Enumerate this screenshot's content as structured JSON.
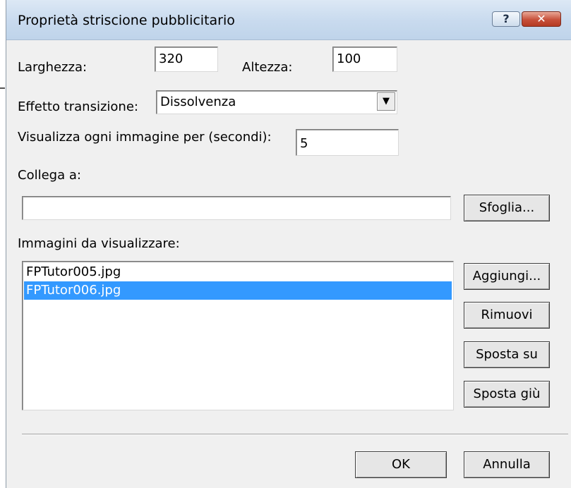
{
  "dialog": {
    "title": "Proprietà striscione pubblicitario",
    "help_glyph": "?",
    "close_glyph": "✕"
  },
  "size": {
    "width_label": "Larghezza:",
    "width_value": "320",
    "height_label": "Altezza:",
    "height_value": "100"
  },
  "transition": {
    "label": "Effetto transizione:",
    "selected": "Dissolvenza",
    "arrow_glyph": "▼"
  },
  "duration": {
    "label": "Visualizza ogni immagine per (secondi):",
    "value": "5"
  },
  "link": {
    "label": "Collega a:",
    "value": "",
    "browse_label": "Sfoglia..."
  },
  "images": {
    "label": "Immagini da visualizzare:",
    "items": [
      {
        "name": "FPTutor005.jpg",
        "selected": false
      },
      {
        "name": "FPTutor006.jpg",
        "selected": true
      }
    ],
    "add_label": "Aggiungi...",
    "remove_label": "Rimuovi",
    "move_up_label": "Sposta su",
    "move_down_label": "Sposta giù"
  },
  "footer": {
    "ok_label": "OK",
    "cancel_label": "Annulla"
  },
  "colors": {
    "selection": "#3399ff",
    "dialog_bg": "#f0f0f0",
    "close_button": "#c7503a"
  },
  "icons": {
    "help": "help-icon",
    "close": "close-icon",
    "dropdown": "chevron-down-icon"
  }
}
